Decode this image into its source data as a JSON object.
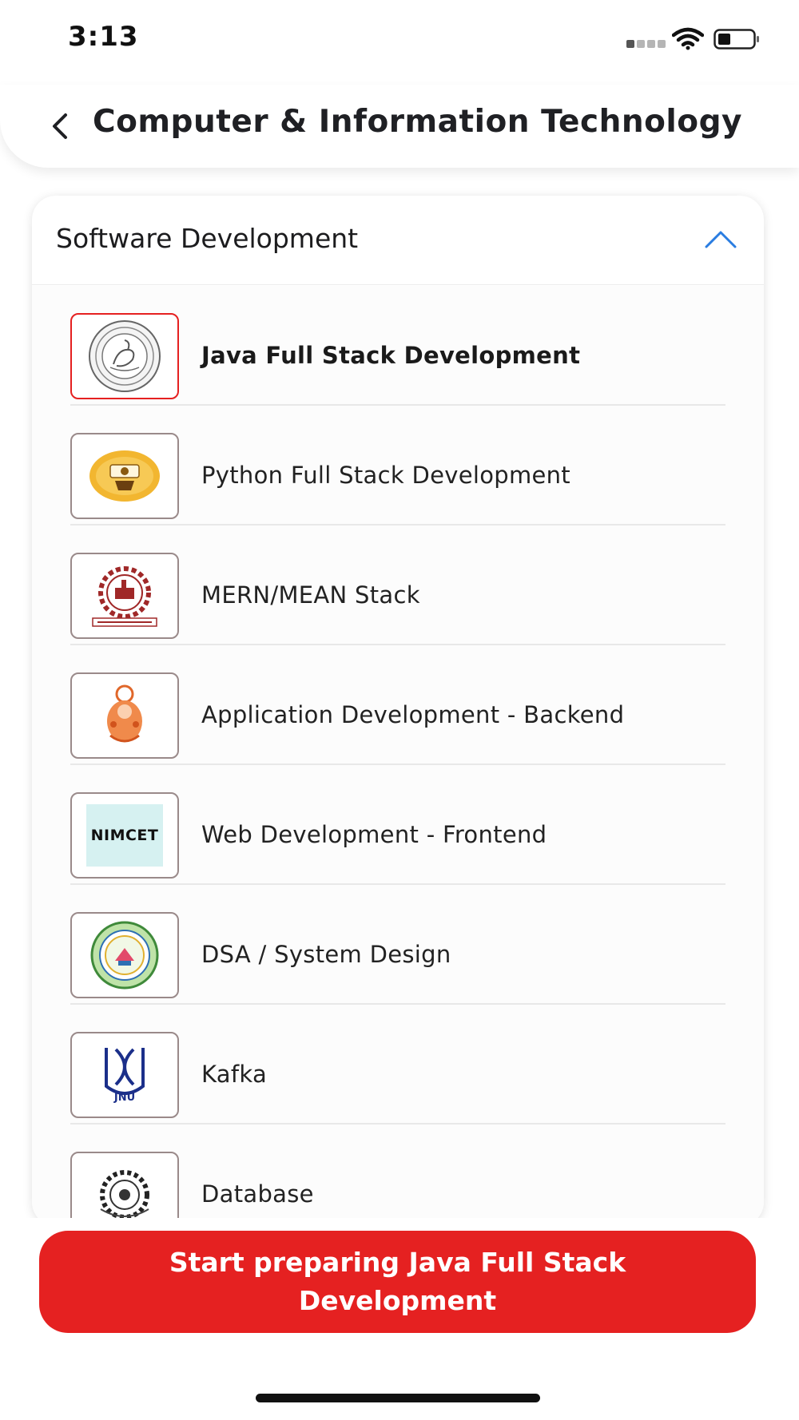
{
  "status_bar": {
    "time": "3:13"
  },
  "header": {
    "title": "Computer & Information Technology"
  },
  "section": {
    "title": "Software Development",
    "expanded": true
  },
  "items": [
    {
      "label": "Java Full Stack Development",
      "logo": "circular-seal-logo",
      "selected": true
    },
    {
      "label": "Python Full Stack Development",
      "logo": "golden-emblem-logo",
      "selected": false
    },
    {
      "label": "MERN/MEAN Stack",
      "logo": "anna-university-gear-logo",
      "selected": false
    },
    {
      "label": "Application Development - Backend",
      "logo": "orange-deity-logo",
      "selected": false
    },
    {
      "label": "Web Development - Frontend",
      "logo": "nimcet-text-logo",
      "logo_text": "NIMCET",
      "selected": false
    },
    {
      "label": "DSA / System Design",
      "logo": "telangana-council-seal-logo",
      "selected": false
    },
    {
      "label": "Kafka",
      "logo": "jnu-logo",
      "logo_text": "JNU",
      "selected": false
    },
    {
      "label": "Database",
      "logo": "gear-emblem-logo",
      "selected": false
    }
  ],
  "cta": {
    "label": "Start preparing Java Full Stack Development"
  },
  "colors": {
    "accent_red": "#e52121",
    "chevron_blue": "#2a7de1",
    "selected_border": "#e52020"
  }
}
